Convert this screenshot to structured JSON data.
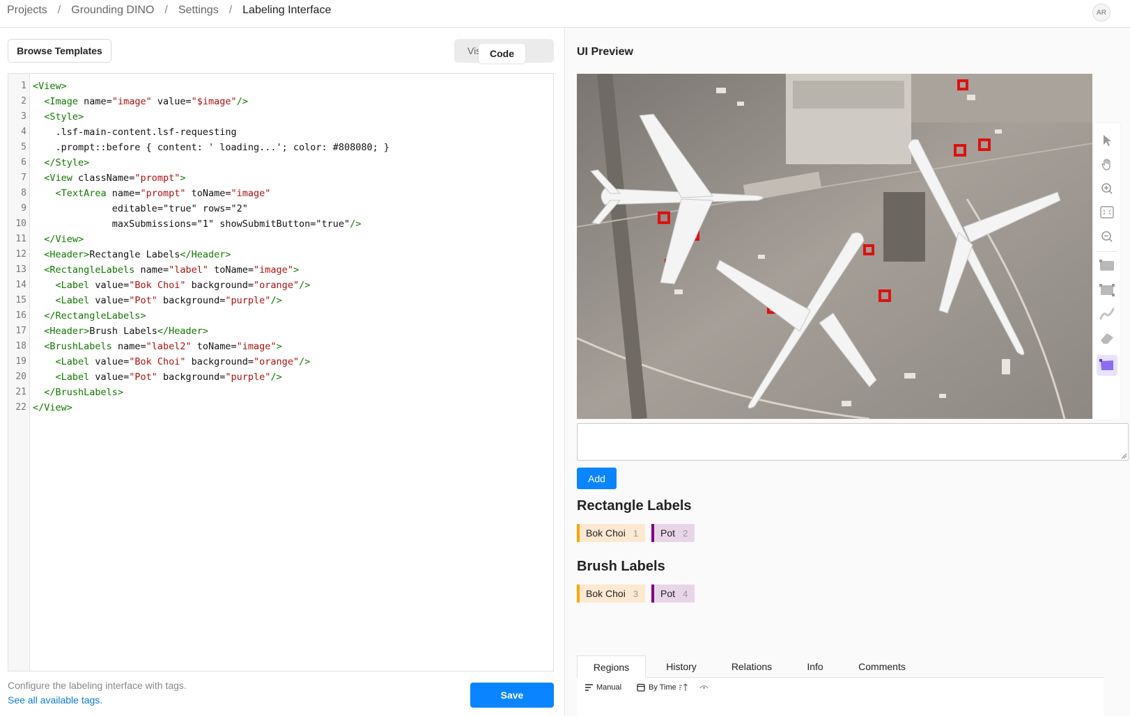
{
  "breadcrumb": {
    "items": [
      "Projects",
      "Grounding DINO",
      "Settings",
      "Labeling Interface"
    ],
    "separator": "/"
  },
  "user": {
    "initials": "AR"
  },
  "editor": {
    "browse_label": "Browse Templates",
    "mode_code": "Code",
    "mode_visual": "Visual",
    "active_mode": "Code",
    "lines": [
      "<View>",
      "  <Image name=\"image\" value=\"$image\"/>",
      "  <Style>",
      "    .lsf-main-content.lsf-requesting",
      "    .prompt::before { content: ' loading...'; color: #808080; }",
      "  </Style>",
      "  <View className=\"prompt\">",
      "    <TextArea name=\"prompt\" toName=\"image\"",
      "              editable=\"true\" rows=\"2\"",
      "              maxSubmissions=\"1\" showSubmitButton=\"true\"/>",
      "  </View>",
      "  <Header>Rectangle Labels</Header>",
      "  <RectangleLabels name=\"label\" toName=\"image\">",
      "    <Label value=\"Bok Choi\" background=\"orange\"/>",
      "    <Label value=\"Pot\" background=\"purple\"/>",
      "  </RectangleLabels>",
      "  <Header>Brush Labels</Header>",
      "  <BrushLabels name=\"label2\" toName=\"image\">",
      "    <Label value=\"Bok Choi\" background=\"orange\"/>",
      "    <Label value=\"Pot\" background=\"purple\"/>",
      "  </BrushLabels>",
      "</View>"
    ],
    "help_text": "Configure the labeling interface with tags.",
    "help_link": "See all available tags",
    "help_link_suffix": ".",
    "save_label": "Save"
  },
  "preview": {
    "title": "UI Preview",
    "image_alt": "aerial-airport-airplanes",
    "add_label": "Add",
    "textarea_value": "",
    "tools": [
      "pointer-icon",
      "hand-pan-icon",
      "zoom-in-icon",
      "fit-icon",
      "zoom-out-icon",
      "rectangle-icon",
      "rectangle-3point-icon",
      "brush-icon",
      "eraser-icon",
      "polygon-icon"
    ],
    "active_tool": "polygon-icon",
    "rectangle_section": {
      "title": "Rectangle Labels",
      "labels": [
        {
          "text": "Bok Choi",
          "hotkey": "1",
          "color": "#ffa500"
        },
        {
          "text": "Pot",
          "hotkey": "2",
          "color": "#800080"
        }
      ]
    },
    "brush_section": {
      "title": "Brush Labels",
      "labels": [
        {
          "text": "Bok Choi",
          "hotkey": "3",
          "color": "#ffa500"
        },
        {
          "text": "Pot",
          "hotkey": "4",
          "color": "#800080"
        }
      ]
    },
    "tabs": [
      "Regions",
      "History",
      "Relations",
      "Info",
      "Comments"
    ],
    "active_tab": "Regions",
    "subbar": {
      "manual": "Manual",
      "by_time": "By Time"
    }
  },
  "colors": {
    "accent": "#0a84ff",
    "orange": "#ffa500",
    "purple": "#800080",
    "tag": "#117700",
    "attr": "#0000cc",
    "string": "#aa1111"
  }
}
